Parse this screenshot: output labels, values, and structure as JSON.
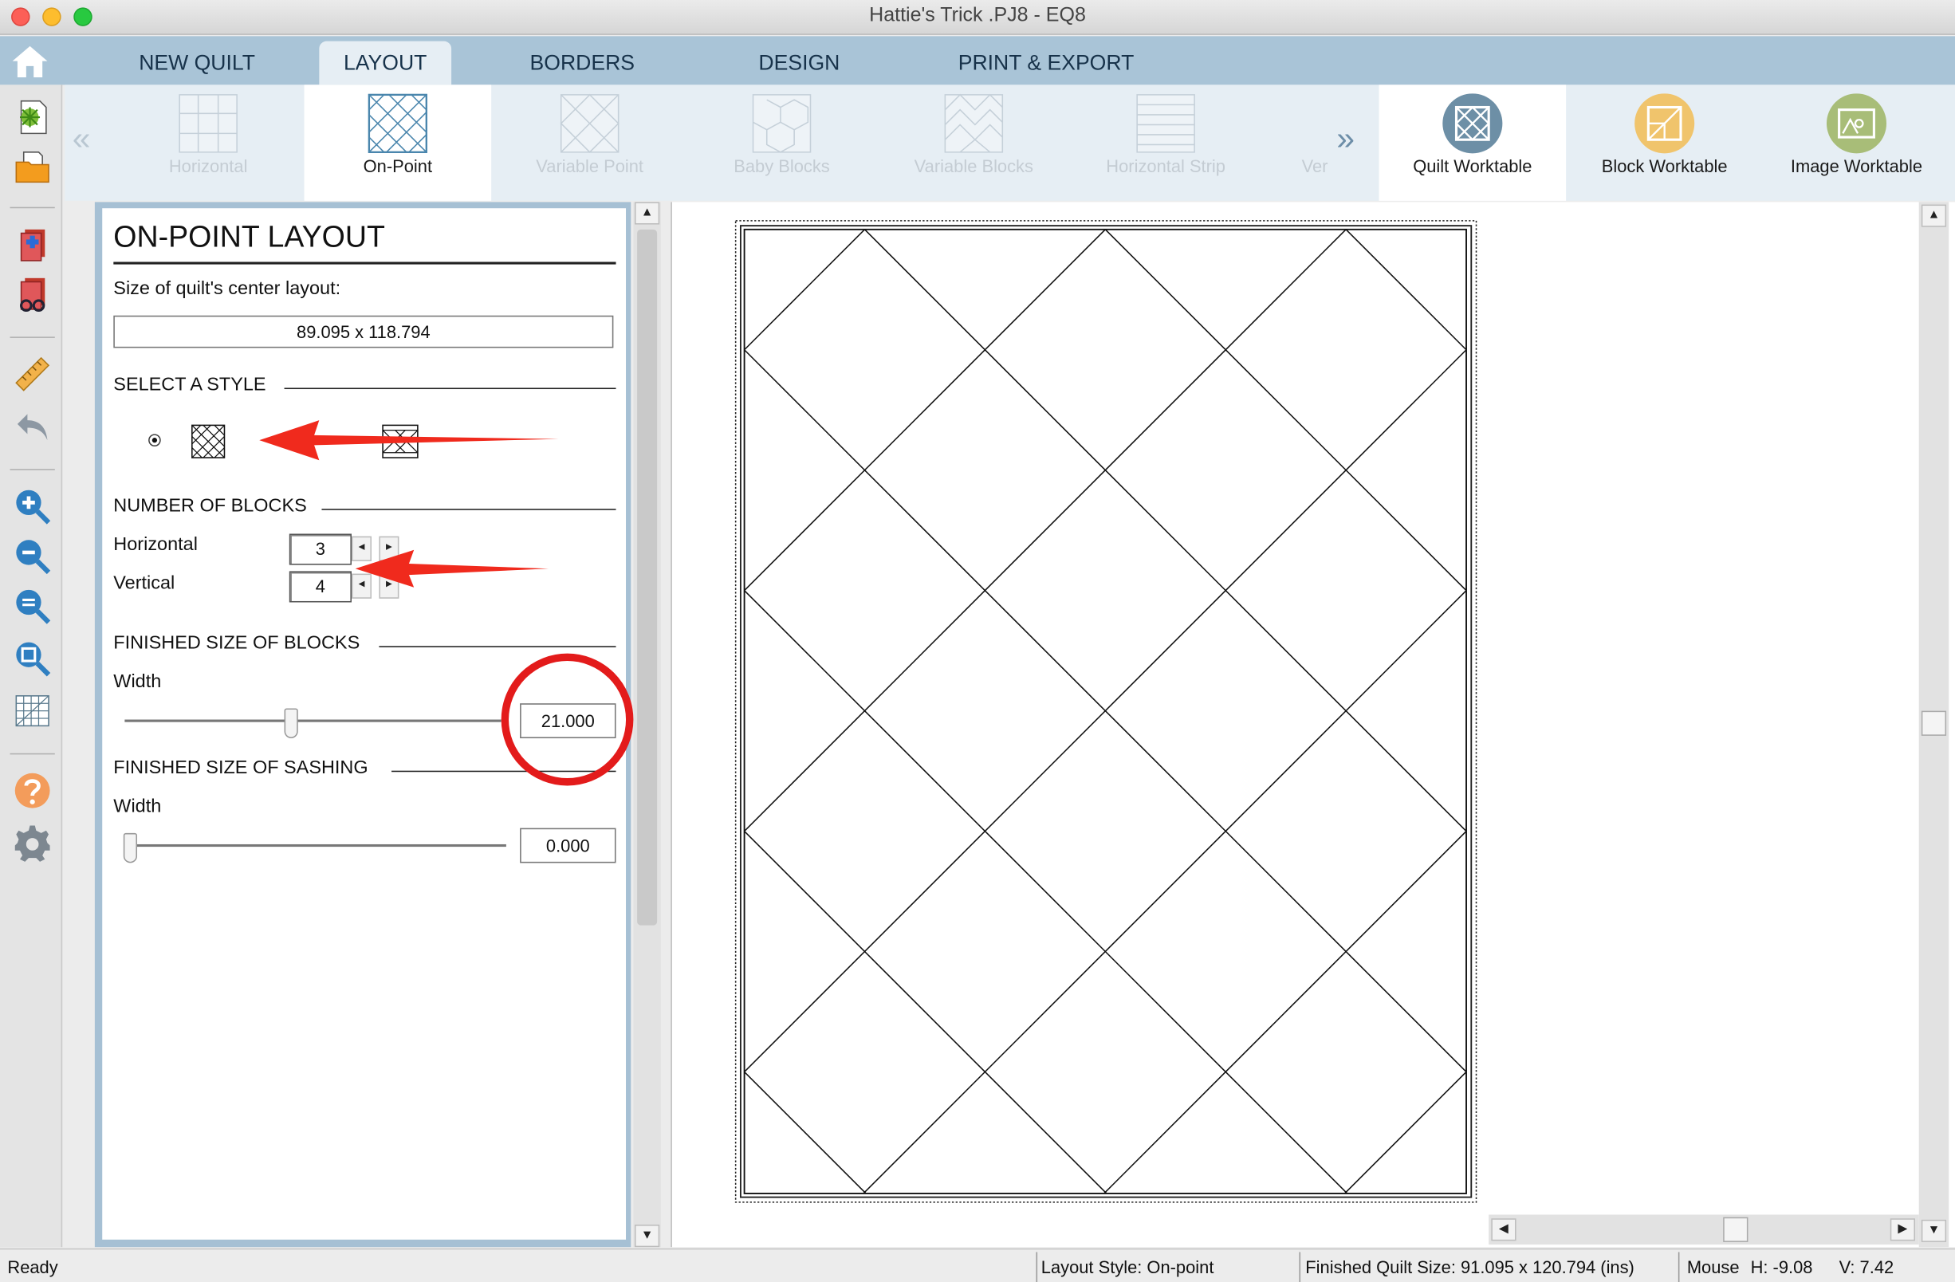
{
  "window": {
    "title": "Hattie's Trick .PJ8 - EQ8"
  },
  "tabs": [
    {
      "label": "NEW QUILT"
    },
    {
      "label": "LAYOUT",
      "active": true
    },
    {
      "label": "BORDERS"
    },
    {
      "label": "DESIGN"
    },
    {
      "label": "PRINT & EXPORT"
    }
  ],
  "ribbon": {
    "layouts": [
      {
        "label": "Horizontal",
        "enabled": false
      },
      {
        "label": "On-Point",
        "enabled": true,
        "selected": true
      },
      {
        "label": "Variable Point",
        "enabled": false
      },
      {
        "label": "Baby Blocks",
        "enabled": false
      },
      {
        "label": "Variable Blocks",
        "enabled": false
      },
      {
        "label": "Horizontal Strip",
        "enabled": false
      },
      {
        "label": "Ver",
        "enabled": false
      }
    ],
    "worktables": [
      {
        "label": "Quilt Worktable",
        "icon": "quilt-worktable-icon",
        "color": "#6d8fa6"
      },
      {
        "label": "Block Worktable",
        "icon": "block-worktable-icon",
        "color": "#f0c46c"
      },
      {
        "label": "Image Worktable",
        "icon": "image-worktable-icon",
        "color": "#a8bd78"
      }
    ]
  },
  "left_toolbar": {
    "icons": [
      "home-icon",
      "add-quilt-icon",
      "open-folder-icon",
      "add-to-sketchbook-icon",
      "view-sketchbook-icon",
      "ruler-icon",
      "undo-icon",
      "zoom-in-icon",
      "zoom-out-icon",
      "zoom-fit-icon",
      "zoom-to-page-icon",
      "graph-paper-icon",
      "help-icon",
      "settings-gear-icon"
    ]
  },
  "panel": {
    "title": "ON-POINT LAYOUT",
    "size_label": "Size of quilt's center layout:",
    "size_value": "89.095 x 118.794",
    "select_style_heading": "SELECT A STYLE",
    "number_of_blocks_heading": "NUMBER OF BLOCKS",
    "horizontal_label": "Horizontal",
    "horizontal_value": "3",
    "vertical_label": "Vertical",
    "vertical_value": "4",
    "finished_blocks_heading": "FINISHED SIZE OF BLOCKS",
    "blocks_width_label": "Width",
    "blocks_width_value": "21.000",
    "blocks_slider_fraction": 0.44,
    "finished_sashing_heading": "FINISHED SIZE OF SASHING",
    "sashing_width_label": "Width",
    "sashing_width_value": "0.000",
    "sashing_slider_fraction": 0.0
  },
  "annotations": {
    "arrow_color": "#f02a1d",
    "circle_color": "#e31b1b"
  },
  "quilt": {
    "horizontal_blocks": 3,
    "vertical_blocks": 4
  },
  "status": {
    "ready": "Ready",
    "layout_style": "Layout Style: On-point",
    "finished_size": "Finished Quilt Size: 91.095 x 120.794 (ins)",
    "mouse_label": "Mouse",
    "h": "H:  -9.08",
    "v": "V:  7.42"
  }
}
